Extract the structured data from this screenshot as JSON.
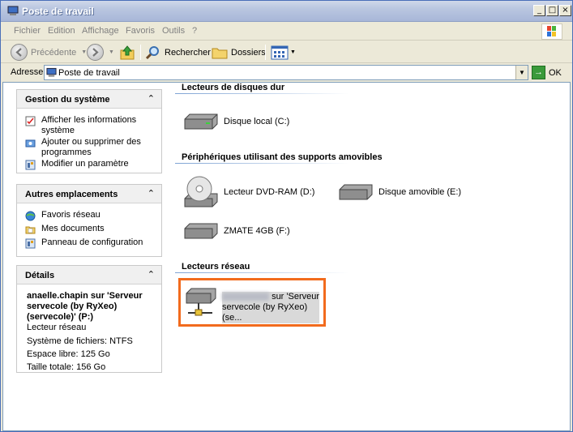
{
  "window": {
    "title": "Poste de travail"
  },
  "menu": [
    "Fichier",
    "Edition",
    "Affichage",
    "Favoris",
    "Outils",
    "?"
  ],
  "toolbar": {
    "back_label": "Précédente",
    "search_label": "Rechercher",
    "folders_label": "Dossiers"
  },
  "address": {
    "label": "Adresse",
    "value": "Poste de travail",
    "go_label": "OK"
  },
  "left": {
    "system": {
      "title": "Gestion du système",
      "items": [
        "Afficher les informations système",
        "Ajouter ou supprimer des programmes",
        "Modifier un paramètre"
      ]
    },
    "places": {
      "title": "Autres emplacements",
      "items": [
        "Favoris réseau",
        "Mes documents",
        "Panneau de configuration"
      ]
    },
    "details": {
      "title": "Détails",
      "name": "anaelle.chapin sur 'Serveur servecole (by RyXeo) (servecole)' (P:)",
      "type": "Lecteur réseau",
      "fs": "Système de fichiers: NTFS",
      "free": "Espace libre: 125 Go",
      "total": "Taille totale: 156 Go"
    }
  },
  "right": {
    "hdd": {
      "title": "Lecteurs de disques dur",
      "items": [
        "Disque local (C:)"
      ]
    },
    "removable": {
      "title": "Périphériques utilisant des supports amovibles",
      "items": [
        "Lecteur DVD-RAM (D:)",
        "Disque amovible (E:)",
        "ZMATE 4GB (F:)"
      ]
    },
    "network": {
      "title": "Lecteurs réseau",
      "item_suffix": "sur 'Serveur servecole (by RyXeo) (se..."
    }
  },
  "colors": {
    "highlight": "#f26b1d",
    "title_text": "#ffffff"
  }
}
